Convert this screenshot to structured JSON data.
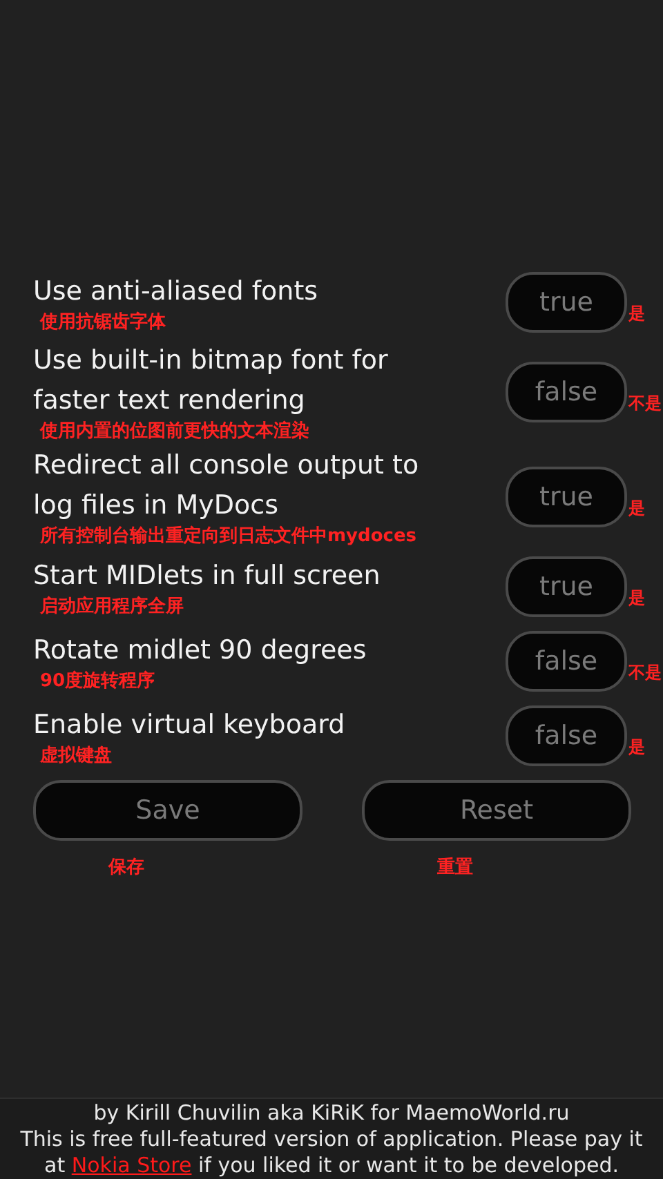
{
  "settings": [
    {
      "label": "Use anti-aliased fonts",
      "note": "使用抗锯齿字体",
      "value": "true",
      "value_note": "是"
    },
    {
      "label": "Use built-in bitmap font for faster text rendering",
      "note": "使用内置的位图前更快的文本渲染",
      "value": "false",
      "value_note": "不是"
    },
    {
      "label": "Redirect all console output to log files in MyDocs",
      "note": "所有控制台输出重定向到日志文件中mydoces",
      "value": "true",
      "value_note": "是"
    },
    {
      "label": "Start MIDlets in full screen",
      "note": "启动应用程序全屏",
      "value": "true",
      "value_note": "是"
    },
    {
      "label": "Rotate midlet 90 degrees",
      "note": "90度旋转程序",
      "value": "false",
      "value_note": "不是"
    },
    {
      "label": "Enable virtual keyboard",
      "note": "虚拟键盘",
      "value": "false",
      "value_note": "是"
    }
  ],
  "buttons": [
    {
      "label": "Save",
      "note": "保存"
    },
    {
      "label": "Reset",
      "note": "重置"
    }
  ],
  "footer": {
    "credit": "by Kirill Chuvilin aka KiRiK for MaemoWorld.ru",
    "notice_before": "This is free full-featured version of application. Please pay it at",
    "link": "Nokia Store",
    "notice_after": "if you liked it or want it to be developed."
  }
}
